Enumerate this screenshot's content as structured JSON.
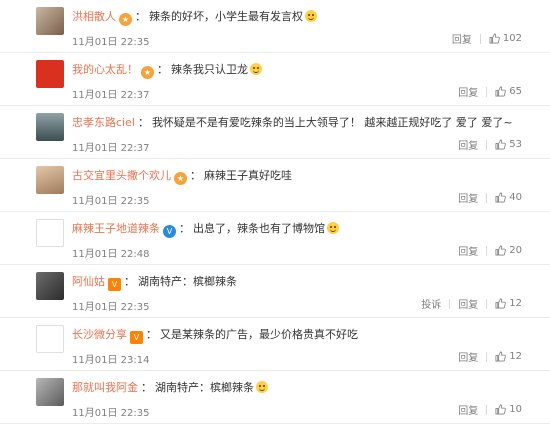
{
  "colors": {
    "username": "#eb7350",
    "meta": "#808080",
    "divider": "#ececec"
  },
  "comments": [
    {
      "user": "洪相散人",
      "badge": "star",
      "text": "辣条的好坏，小学生最有发言权",
      "has_emoji": true,
      "time": "11月01日 22:35",
      "reply": "回复",
      "report": "",
      "likes": "102"
    },
    {
      "user": "我的心太乱！",
      "badge": "star",
      "text": "辣条我只认卫龙",
      "has_emoji": true,
      "time": "11月01日 22:37",
      "reply": "回复",
      "report": "",
      "likes": "65"
    },
    {
      "user": "忠孝东路ciel",
      "badge": "",
      "text": "我怀疑是不是有爱吃辣条的当上大领导了！ 越来越正规好吃了 爱了 爱了~",
      "has_emoji": false,
      "time": "11月01日 22:37",
      "reply": "回复",
      "report": "",
      "likes": "53"
    },
    {
      "user": "古交宜里头撒个欢儿",
      "badge": "star",
      "text": "麻辣王子真好吃哇",
      "has_emoji": false,
      "time": "11月01日 22:35",
      "reply": "回复",
      "report": "",
      "likes": "40"
    },
    {
      "user": "麻辣王子地道辣条",
      "badge": "v",
      "text": "出息了，辣条也有了博物馆",
      "has_emoji": true,
      "time": "11月01日 22:48",
      "reply": "回复",
      "report": "",
      "likes": "20"
    },
    {
      "user": "阿仙姑",
      "badge": "vip",
      "text": "湖南特产：槟榔辣条",
      "has_emoji": false,
      "time": "11月01日 22:35",
      "reply": "回复",
      "report": "投诉",
      "likes": "12"
    },
    {
      "user": "长沙微分享",
      "badge": "vip",
      "text": "又是某辣条的广告，最少价格贵真不好吃",
      "has_emoji": false,
      "time": "11月01日 23:14",
      "reply": "回复",
      "report": "",
      "likes": "12"
    },
    {
      "user": "那就叫我阿金",
      "badge": "",
      "text": "湖南特产：槟榔辣条",
      "has_emoji": true,
      "time": "11月01日 22:35",
      "reply": "回复",
      "report": "",
      "likes": "10"
    }
  ]
}
